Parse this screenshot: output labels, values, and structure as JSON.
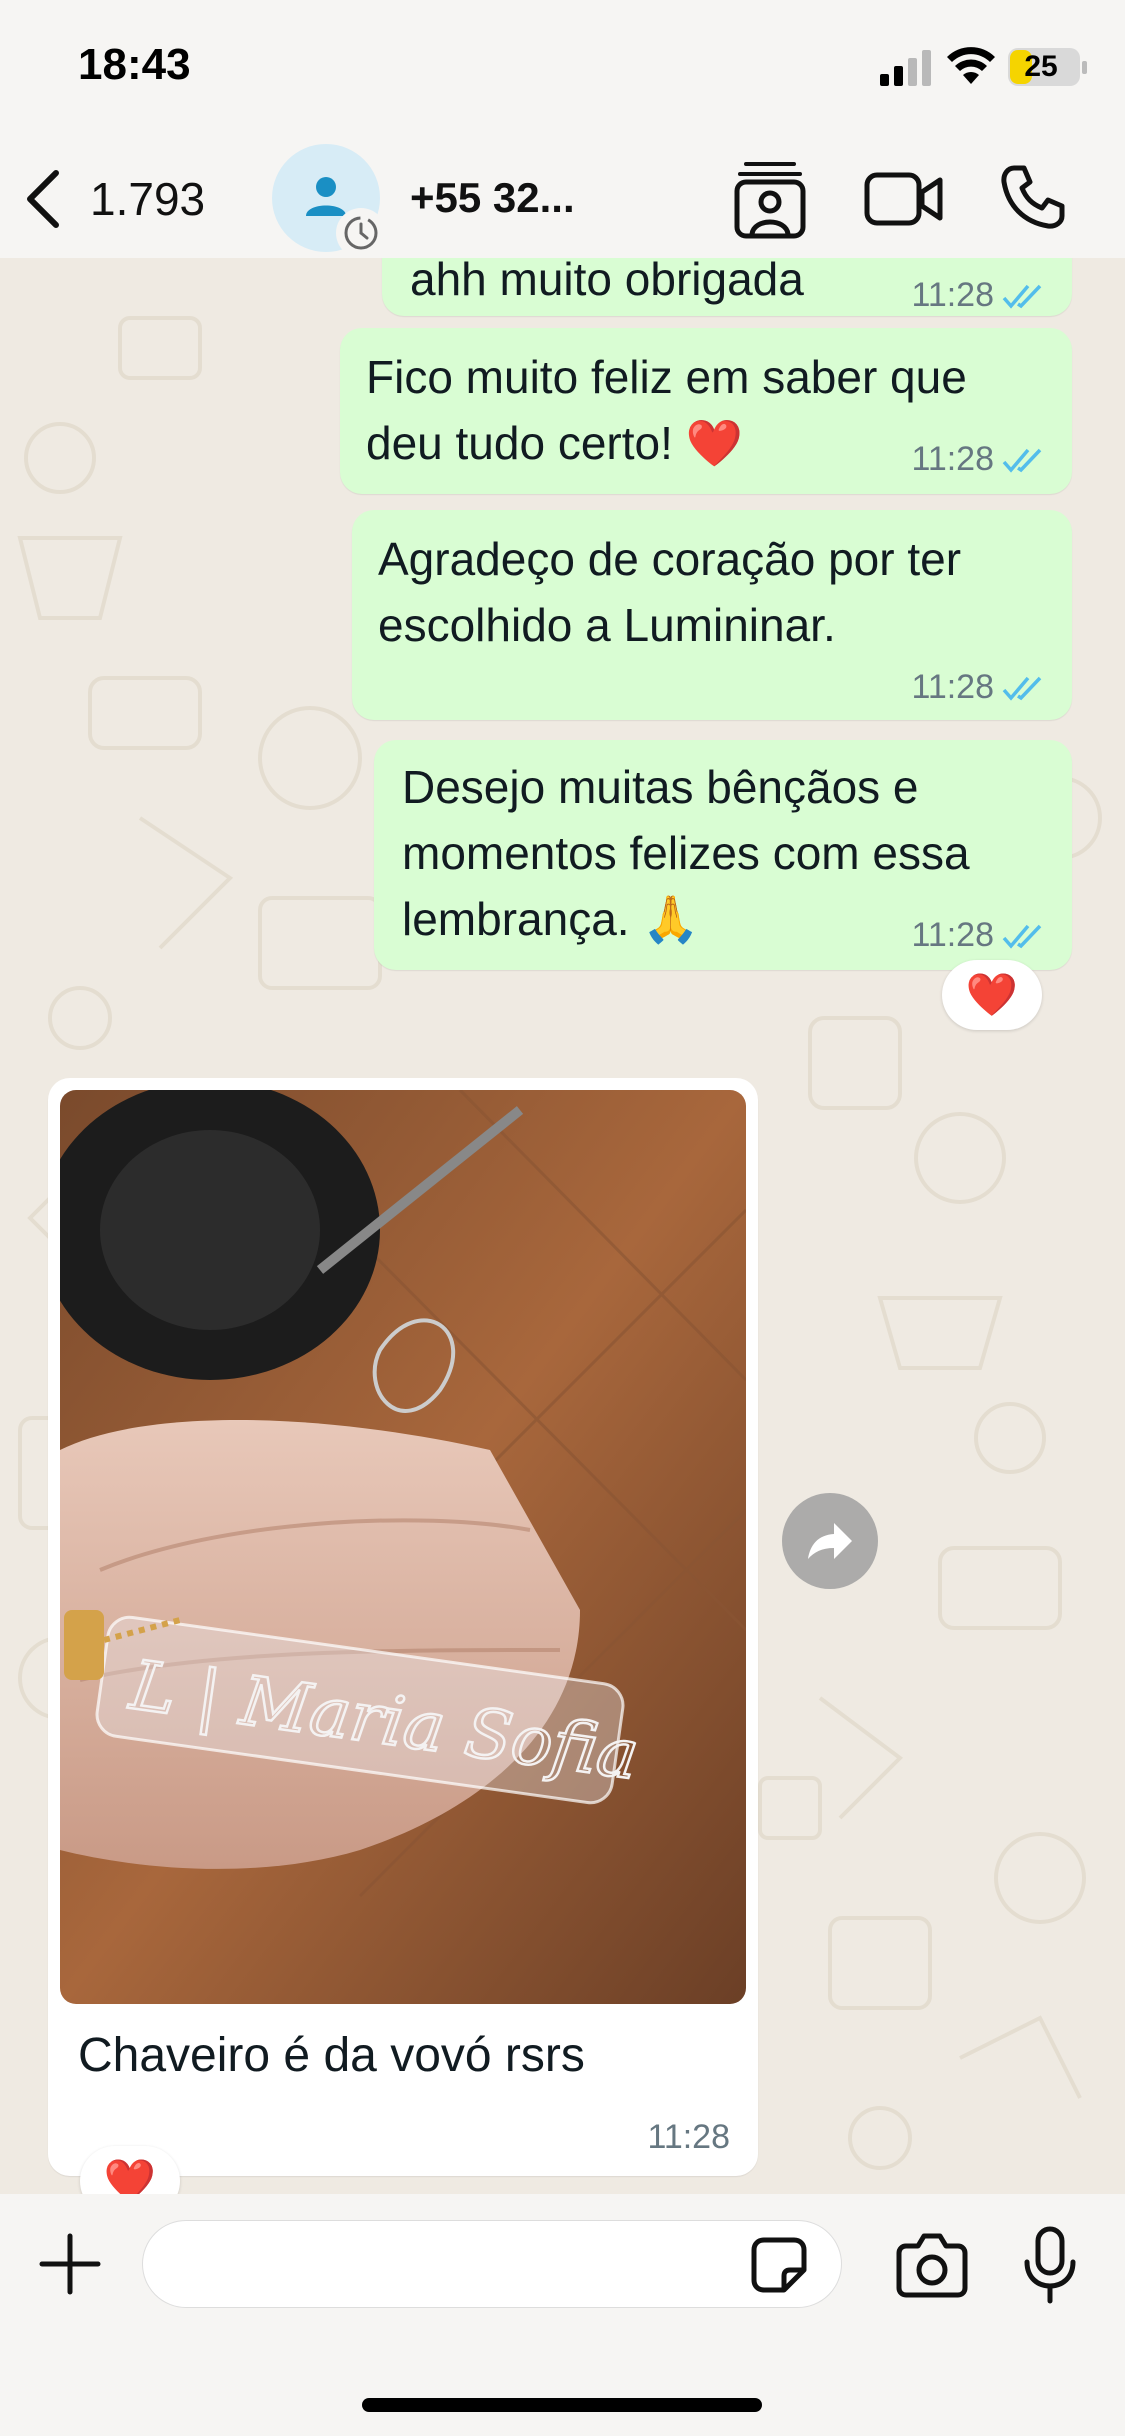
{
  "status_bar": {
    "time": "18:43",
    "battery": "25",
    "icons": [
      "signal-icon",
      "wifi-icon",
      "battery-icon"
    ]
  },
  "header": {
    "back_count": "1.793",
    "contact_name": "+55 32...",
    "icons": [
      "chevron-left-icon",
      "avatar-person-icon",
      "disappearing-timer-icon",
      "contact-card-icon",
      "video-call-icon",
      "phone-call-icon"
    ]
  },
  "messages": [
    {
      "direction": "out",
      "text": "ahh muito obrigada",
      "time": "11:28",
      "status": "read"
    },
    {
      "direction": "out",
      "text_lines": [
        "Fico muito feliz em saber que",
        "deu tudo certo! ❤️"
      ],
      "time": "11:28",
      "status": "read"
    },
    {
      "direction": "out",
      "text_lines": [
        "Agradeço de coração por ter",
        "escolhido a Lumininar."
      ],
      "time": "11:28",
      "status": "read"
    },
    {
      "direction": "out",
      "text_lines": [
        "Desejo muitas bênçãos e",
        "momentos felizes com essa",
        "lembrança. 🙏"
      ],
      "time": "11:28",
      "status": "read",
      "reaction": "❤️"
    },
    {
      "direction": "in",
      "type": "image",
      "image_text": "L | Maria Sofia",
      "caption": "Chaveiro é da vovó rsrs",
      "time": "11:28",
      "reaction": "❤️"
    }
  ],
  "input": {
    "placeholder": "",
    "icons": [
      "plus-icon",
      "sticker-icon",
      "camera-icon",
      "microphone-icon"
    ]
  },
  "colors": {
    "outgoing_bubble": "#d9fdd3",
    "incoming_bubble": "#ffffff",
    "read_ticks": "#53bdeb",
    "background": "#efeae2"
  }
}
